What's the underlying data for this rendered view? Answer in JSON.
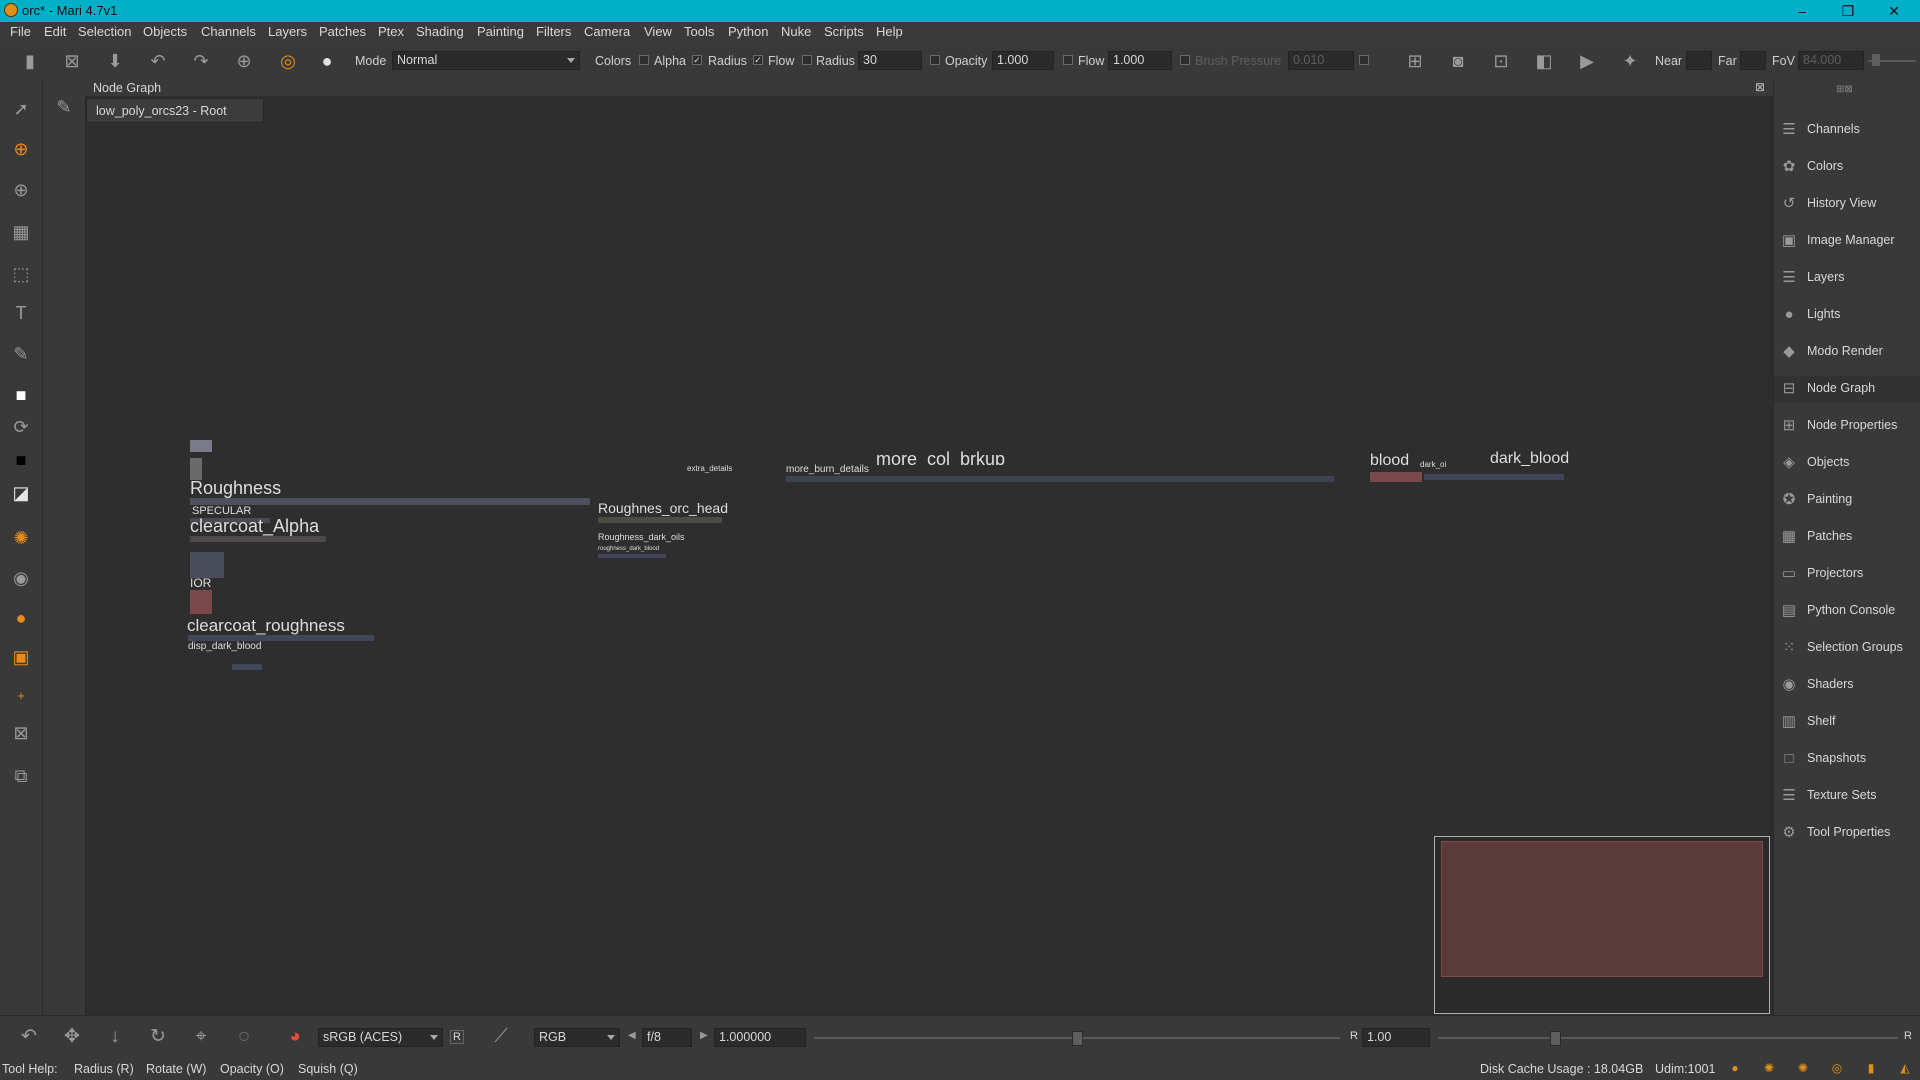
{
  "window": {
    "title": "orc* - Mari 4.7v1",
    "minimize": "–",
    "restore": "❐",
    "close": "✕"
  },
  "menu": [
    "File",
    "Edit",
    "Selection",
    "Objects",
    "Channels",
    "Layers",
    "Patches",
    "Ptex",
    "Shading",
    "Painting",
    "Filters",
    "Camera",
    "View",
    "Tools",
    "Python",
    "Nuke",
    "Scripts",
    "Help"
  ],
  "toolbar": {
    "mode_label": "Mode",
    "mode_value": "Normal",
    "colors_label": "Colors",
    "alpha_label": "Alpha",
    "radius_chk_label": "Radius",
    "flow_chk_label": "Flow",
    "radius_label": "Radius",
    "radius_value": "30",
    "opacity_label": "Opacity",
    "opacity_value": "1.000",
    "flow_label": "Flow",
    "flow_value": "1.000",
    "brush_pressure_label": "Brush Pressure",
    "brush_pressure_value": "0.010",
    "near_label": "Near",
    "far_label": "Far",
    "fov_label": "FoV",
    "fov_value": "84.000"
  },
  "node_graph": {
    "panel_title": "Node Graph",
    "tab_label": "low_poly_orcs23 - Root",
    "labels": {
      "roughness": "Roughness",
      "specular": "SPECULAR",
      "clearcoat_alpha": "clearcoat_Alpha",
      "ior": "IOR",
      "clearcoat_roughness": "clearcoat_roughness",
      "disp_dark_blood": "disp_dark_blood",
      "roughnes_orc_head": "Roughnes_orc_head",
      "roughness_dark_oils": "Roughness_dark_oils",
      "roughness_dark_blood": "roughness_dark_blood",
      "extra_details": "extra_details",
      "more_burn_details": "more_burn_details",
      "more_col_brkup": "more_col_brkup",
      "blood": "blood",
      "dark_oi": "dark_oi",
      "dark_blood": "dark_blood"
    }
  },
  "right_panel": [
    {
      "label": "Channels",
      "icon": "channels-icon",
      "glyph": "☰"
    },
    {
      "label": "Colors",
      "icon": "colors-icon",
      "glyph": "✿"
    },
    {
      "label": "History View",
      "icon": "history-icon",
      "glyph": "↺"
    },
    {
      "label": "Image Manager",
      "icon": "image-manager-icon",
      "glyph": "▣"
    },
    {
      "label": "Layers",
      "icon": "layers-icon",
      "glyph": "☰"
    },
    {
      "label": "Lights",
      "icon": "lights-icon",
      "glyph": "●"
    },
    {
      "label": "Modo Render",
      "icon": "modo-render-icon",
      "glyph": "◆"
    },
    {
      "label": "Node Graph",
      "icon": "node-graph-icon",
      "glyph": "⊟"
    },
    {
      "label": "Node Properties",
      "icon": "node-properties-icon",
      "glyph": "⊞"
    },
    {
      "label": "Objects",
      "icon": "objects-icon",
      "glyph": "◈"
    },
    {
      "label": "Painting",
      "icon": "painting-icon",
      "glyph": "✪"
    },
    {
      "label": "Patches",
      "icon": "patches-icon",
      "glyph": "▦"
    },
    {
      "label": "Projectors",
      "icon": "projectors-icon",
      "glyph": "▭"
    },
    {
      "label": "Python Console",
      "icon": "python-console-icon",
      "glyph": "▤"
    },
    {
      "label": "Selection Groups",
      "icon": "selection-groups-icon",
      "glyph": "⁙"
    },
    {
      "label": "Shaders",
      "icon": "shaders-icon",
      "glyph": "◉"
    },
    {
      "label": "Shelf",
      "icon": "shelf-icon",
      "glyph": "▥"
    },
    {
      "label": "Snapshots",
      "icon": "snapshots-icon",
      "glyph": "□"
    },
    {
      "label": "Texture Sets",
      "icon": "texture-sets-icon",
      "glyph": "☰"
    },
    {
      "label": "Tool Properties",
      "icon": "tool-properties-icon",
      "glyph": "⚙"
    }
  ],
  "bottom": {
    "colorspace_value": "sRGB (ACES)",
    "r_button": "R",
    "channel_value": "RGB",
    "fstop_value": "f/8",
    "gain_value": "1.000000",
    "r_label": "R",
    "gamma_value": "1.00",
    "r_end": "R"
  },
  "status": {
    "tool_help": "Tool Help:",
    "hints": [
      "Radius (R)",
      "Rotate (W)",
      "Opacity (O)",
      "Squish (Q)"
    ],
    "disk_cache": "Disk Cache Usage : 18.04GB",
    "udim": "Udim:1001"
  },
  "colors": {
    "titlebar": "#00b0c8",
    "accent": "#e88b1a",
    "panel": "#393939",
    "canvas": "#2e2e2e"
  }
}
